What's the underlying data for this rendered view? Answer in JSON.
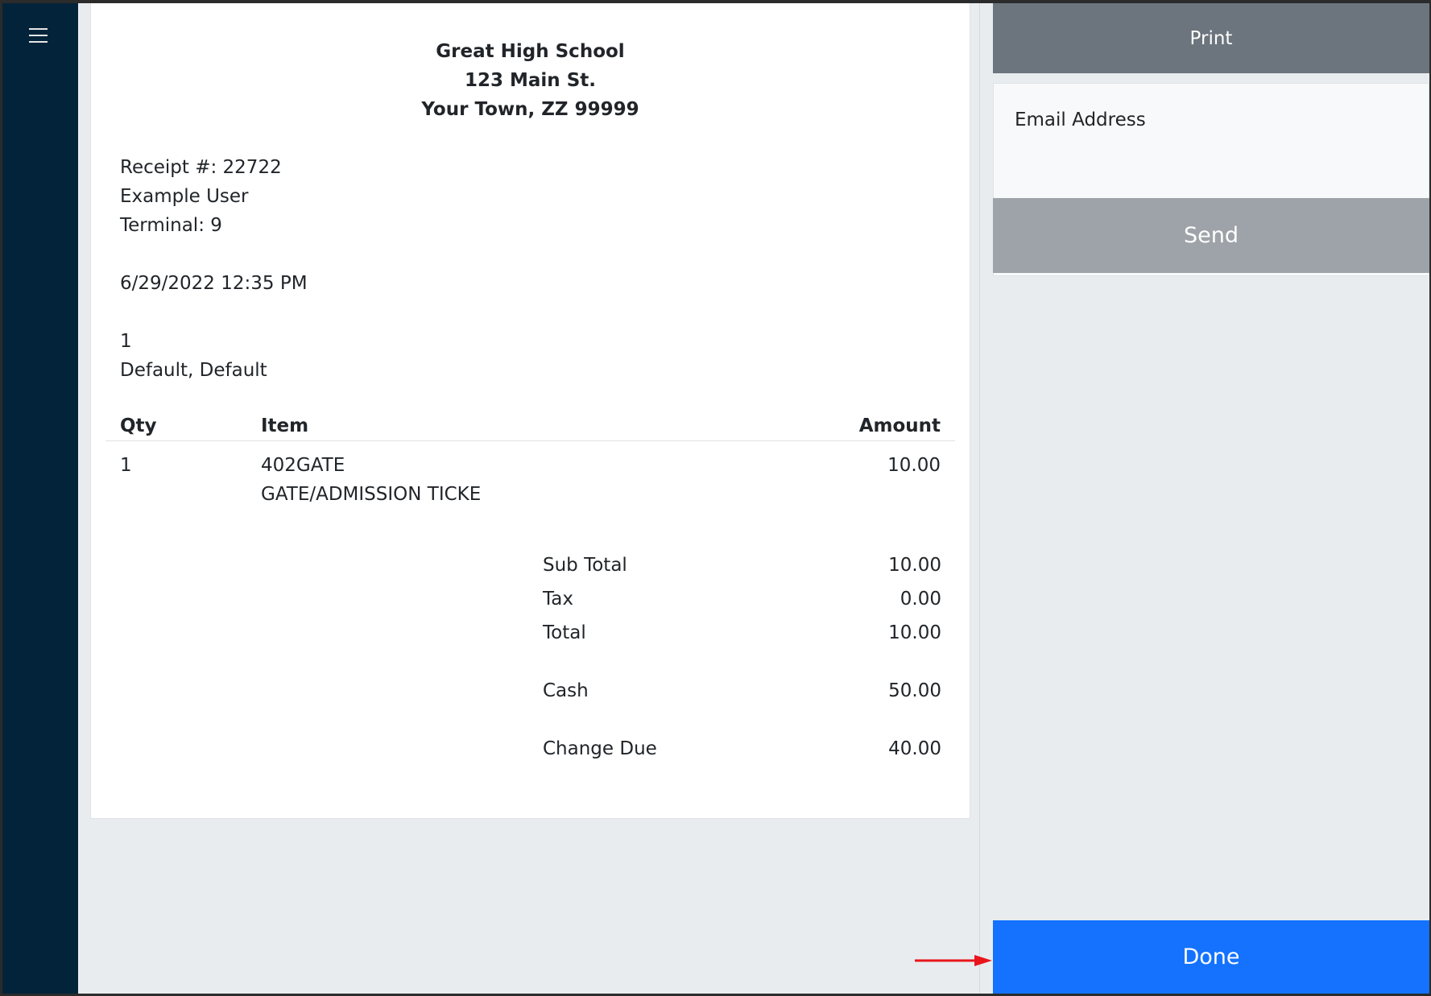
{
  "receipt": {
    "school_name": "Great High School",
    "address_line1": "123 Main St.",
    "address_line2": "Your Town, ZZ 99999",
    "receipt_number": "Receipt #: 22722",
    "user": "Example User",
    "terminal": "Terminal: 9",
    "datetime": "6/29/2022 12:35 PM",
    "customer_id": "1",
    "customer_name": "Default, Default",
    "columns": {
      "qty": "Qty",
      "item": "Item",
      "amount": "Amount"
    },
    "line_items": [
      {
        "qty": "1",
        "code": "402GATE",
        "description": "GATE/ADMISSION TICKE",
        "amount": "10.00"
      }
    ],
    "totals": {
      "subtotal_label": "Sub Total",
      "subtotal_value": "10.00",
      "tax_label": "Tax",
      "tax_value": "0.00",
      "total_label": "Total",
      "total_value": "10.00",
      "cash_label": "Cash",
      "cash_value": "50.00",
      "change_label": "Change Due",
      "change_value": "40.00"
    }
  },
  "actions": {
    "print_label": "Print",
    "email_label": "Email Address",
    "email_value": "",
    "email_placeholder": "",
    "send_label": "Send",
    "done_label": "Done"
  },
  "icons": {
    "menu": "hamburger-menu-icon",
    "pointer": "red-arrow-annotation"
  },
  "colors": {
    "sidebar": "#03233a",
    "print_button": "#6c757d",
    "send_button": "#9ea3a9",
    "done_button": "#1472ff",
    "annotation_arrow": "#e8161b"
  }
}
